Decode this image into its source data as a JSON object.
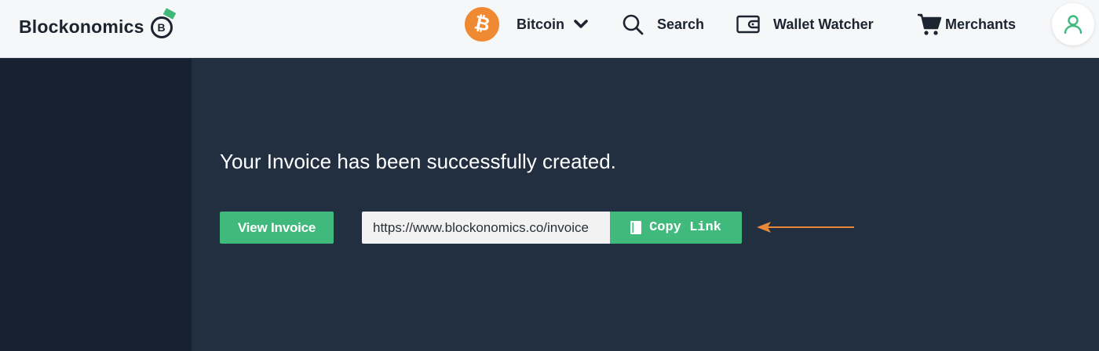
{
  "header": {
    "brand": {
      "name": "Blockonomics",
      "logo_letter": "B"
    },
    "nav": [
      {
        "label": "Bitcoin",
        "icon": "bitcoin-icon",
        "has_dropdown": true
      },
      {
        "label": "Search",
        "icon": "search-icon"
      },
      {
        "label": "Wallet Watcher",
        "icon": "wallet-icon"
      },
      {
        "label": "Merchants",
        "icon": "cart-icon"
      }
    ],
    "user_icon": "user-icon"
  },
  "main": {
    "success_message": "Your Invoice has been successfully created.",
    "view_invoice_label": "View Invoice",
    "invoice_link": "https://www.blockonomics.co/invoice",
    "copy_link_label": "Copy Link"
  },
  "colors": {
    "accent_green": "#3fba7c",
    "bitcoin_orange": "#f08a32",
    "content_bg": "#212f41",
    "sidebar_bg": "#17212f",
    "annotation_arrow": "#e8893a"
  }
}
